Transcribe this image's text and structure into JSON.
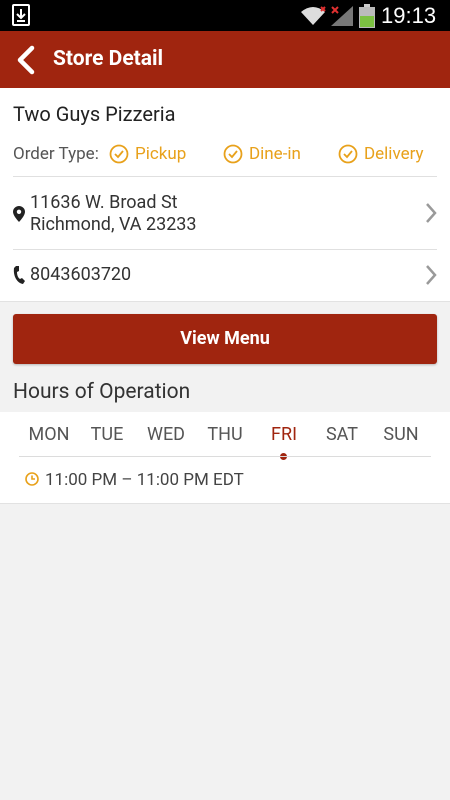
{
  "status_bar": {
    "time": "19:13"
  },
  "app_bar": {
    "title": "Store Detail"
  },
  "store": {
    "name": "Two Guys Pizzeria",
    "order_type_label": "Order Type:",
    "order_types": [
      "Pickup",
      "Dine-in",
      "Delivery"
    ],
    "address_line1": "11636 W. Broad St",
    "address_line2": "Richmond, VA 23233",
    "phone": "8043603720"
  },
  "view_menu_label": "View Menu",
  "hours": {
    "title": "Hours of Operation",
    "days": [
      "MON",
      "TUE",
      "WED",
      "THU",
      "FRI",
      "SAT",
      "SUN"
    ],
    "selected_day": "FRI",
    "time_range": "11:00 PM – 11:00 PM EDT"
  },
  "colors": {
    "brand": "#a0250f",
    "accent": "#e8a11b"
  },
  "icons": [
    "download-icon",
    "wifi-icon",
    "signal-icon",
    "battery-icon",
    "back-arrow-icon",
    "check-circle-icon",
    "location-pin-icon",
    "phone-icon",
    "chevron-right-icon",
    "clock-icon"
  ]
}
